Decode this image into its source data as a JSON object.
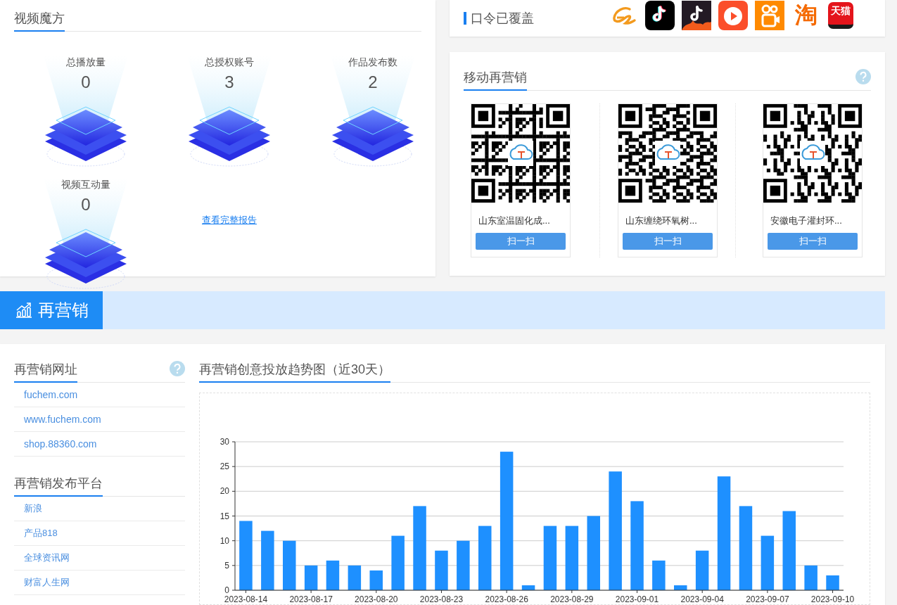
{
  "video_cube": {
    "title": "视频魔方",
    "stats": [
      {
        "label": "总播放量",
        "value": "0"
      },
      {
        "label": "总授权账号",
        "value": "3"
      },
      {
        "label": "作品发布数",
        "value": "2"
      },
      {
        "label": "视频互动量",
        "value": "0"
      }
    ],
    "report_link": "查看完整报告"
  },
  "coverage": {
    "title": "口令已覆盖",
    "platforms": [
      {
        "kind": "alibaba"
      },
      {
        "kind": "douyin"
      },
      {
        "kind": "douyin_fire"
      },
      {
        "kind": "huoshan"
      },
      {
        "kind": "kuaishou"
      },
      {
        "kind": "taobao",
        "text": "淘"
      },
      {
        "kind": "tmall",
        "text": "天猫"
      }
    ]
  },
  "mobile_remarketing": {
    "title": "移动再营销",
    "cards": [
      {
        "name": "山东室温固化成...",
        "button": "扫一扫"
      },
      {
        "name": "山东缠绕环氧树...",
        "button": "扫一扫"
      },
      {
        "name": "安徽电子灌封环...",
        "button": "扫一扫"
      }
    ]
  },
  "section_banner": {
    "title": "再营销"
  },
  "remarketing_urls": {
    "title": "再营销网址",
    "items": [
      "fuchem.com",
      "www.fuchem.com",
      "shop.88360.com"
    ]
  },
  "publish_platforms": {
    "title": "再营销发布平台",
    "items": [
      "新浪",
      "产品818",
      "全球资讯网",
      "财富人生网"
    ]
  },
  "trend": {
    "title": "再营销创意投放趋势图（近30天）",
    "chart_data": {
      "type": "bar",
      "categories": [
        "2023-08-14",
        null,
        null,
        "2023-08-17",
        null,
        null,
        "2023-08-20",
        null,
        null,
        "2023-08-23",
        null,
        null,
        "2023-08-26",
        null,
        null,
        "2023-08-29",
        null,
        null,
        "2023-09-01",
        null,
        null,
        "2023-09-04",
        null,
        null,
        "2023-09-07",
        null,
        null,
        "2023-09-10"
      ],
      "grid": true,
      "series": [
        {
          "color": "#1e90ff",
          "values": [
            14,
            12,
            10,
            5,
            6,
            5,
            4,
            11,
            17,
            8,
            10,
            13,
            28,
            1,
            13,
            13,
            15,
            24,
            18,
            6,
            1,
            8,
            23,
            17,
            11,
            16,
            5,
            3
          ]
        }
      ],
      "ylim": [
        0,
        30
      ],
      "yticks": [
        0,
        5,
        10,
        15,
        20,
        25,
        30
      ]
    }
  }
}
